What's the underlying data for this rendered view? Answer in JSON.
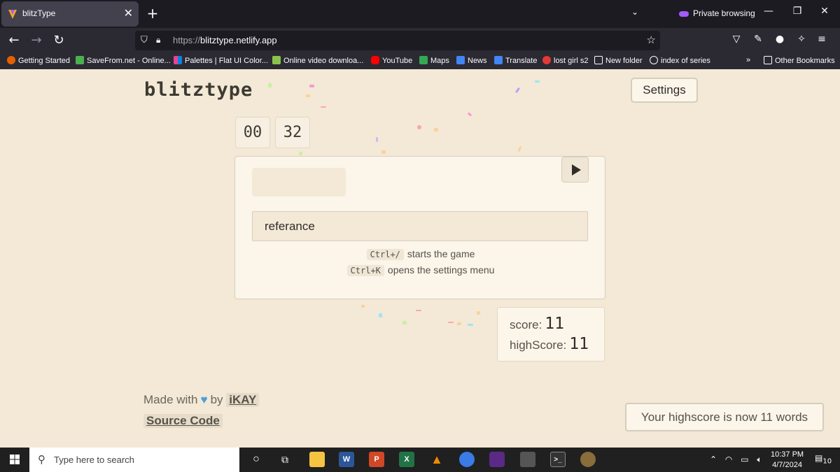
{
  "browser": {
    "tab_title": "blitzType",
    "tab_close": "✕",
    "new_tab": "+",
    "tab_list": "⌄",
    "private_label": "Private browsing",
    "url_proto": "https://",
    "url_host": "blitztype.netlify.app",
    "bookmarks": [
      {
        "label": "Getting Started",
        "color": "#e66000"
      },
      {
        "label": "SaveFrom.net - Online...",
        "color": "#4caf50"
      },
      {
        "label": "Palettes | Flat UI Color...",
        "color": "#e84393"
      },
      {
        "label": "Online video downloa...",
        "color": "#8bc34a"
      },
      {
        "label": "YouTube",
        "color": "#ff0000"
      },
      {
        "label": "Maps",
        "color": "#34a853"
      },
      {
        "label": "News",
        "color": "#4285f4"
      },
      {
        "label": "Translate",
        "color": "#4285f4"
      },
      {
        "label": "lost girl s2",
        "color": "#e53935"
      },
      {
        "label": "New folder",
        "color": "#2b2a33"
      },
      {
        "label": "index of series",
        "color": "#2b2a33"
      }
    ],
    "other_bookmarks": "Other Bookmarks"
  },
  "app": {
    "logo": "blitztype",
    "settings_label": "Settings",
    "timer": {
      "minutes": "00",
      "seconds": "32"
    },
    "input_value": "referance",
    "hints": [
      {
        "key": "Ctrl+/",
        "text": "starts the game"
      },
      {
        "key": "Ctrl+K",
        "text": "opens the settings menu"
      }
    ],
    "score_label": "score:",
    "score_value": "11",
    "highscore_label": "highScore:",
    "highscore_value": "11",
    "made_with": "Made with",
    "by": "by",
    "author": "iKAY",
    "source_code": "Source Code",
    "toast": "Your highscore is now 11 words"
  },
  "taskbar": {
    "search_placeholder": "Type here to search",
    "time": "10:37 PM",
    "date": "4/7/2024",
    "notifications": "10"
  }
}
